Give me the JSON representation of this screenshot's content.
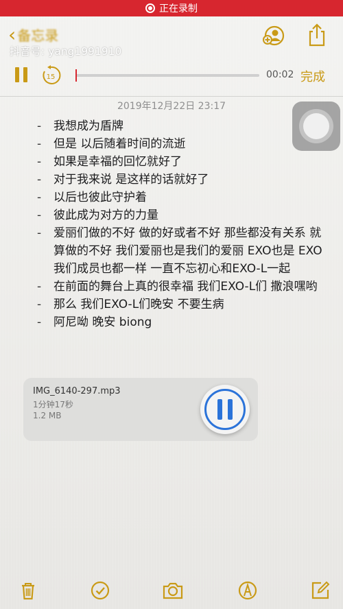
{
  "recording_bar": {
    "text": "正在录制"
  },
  "nav": {
    "back_label": "备忘录",
    "watermark": "抖音号: yang1991910"
  },
  "player": {
    "skip_seconds": "15",
    "time": "00:02",
    "done_label": "完成"
  },
  "note": {
    "date": "2019年12月22日 23:17",
    "lines": [
      "我想成为盾牌",
      "但是 以后随着时间的流逝",
      "如果是幸福的回忆就好了",
      "对于我来说 是这样的话就好了",
      "以后也彼此守护着",
      "彼此成为对方的力量",
      "爱丽们做的不好 做的好或者不好 那些都没有关系 就算做的不好  我们爱丽也是我们的爱丽 EXO也是 EXO 我们成员也都一样  一直不忘初心和EXO-L一起",
      "在前面的舞台上真的很幸福  我们EXO-L们 撒浪嘿哟",
      "那么  我们EXO-L们晚安  不要生病",
      "阿尼呦 晚安  biong"
    ]
  },
  "attachment": {
    "filename": "IMG_6140-297.mp3",
    "duration": "1分钟17秒",
    "size": "1.2 MB"
  },
  "colors": {
    "accent": "#c99a16",
    "recording": "#d7262f",
    "audio_control": "#2b73d9"
  },
  "icons": {
    "toolbar": [
      "trash-icon",
      "checklist-icon",
      "camera-icon",
      "markup-icon",
      "compose-icon"
    ]
  }
}
